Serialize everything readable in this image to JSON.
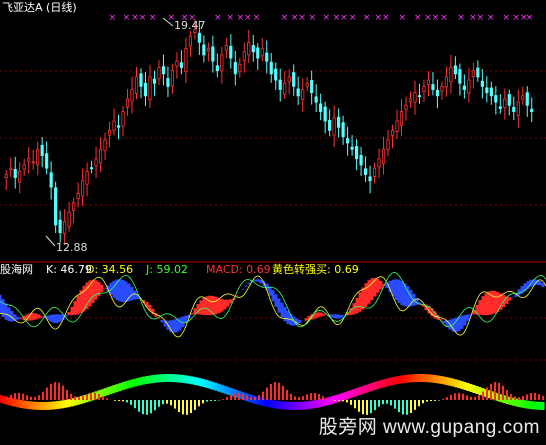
{
  "title": "飞亚达A (日线)",
  "high_marker": "19.47",
  "low_marker": "12.88",
  "indicator": {
    "name": "股海网",
    "k": "K: 46.79",
    "d": "D: 34.56",
    "j": "J: 59.02",
    "macd": "MACD: 0.69",
    "signal": "黄色转强买: 0.69"
  },
  "watermark": "股旁网 www.gupang.com",
  "colors": {
    "background": "#000000",
    "candle_up": "#ff3232",
    "candle_down": "#54ffff",
    "marker": "#ff33ff",
    "grid": "#8b0000"
  },
  "chart_data": [
    {
      "type": "candlestick",
      "title": "飞亚达A (日线)",
      "annotations": [
        {
          "label": "19.47",
          "meaning": "period high"
        },
        {
          "label": "12.88",
          "meaning": "period low"
        }
      ],
      "close": [
        14.8,
        15.0,
        14.7,
        14.9,
        15.1,
        15.3,
        15.2,
        15.6,
        15.4,
        15.0,
        14.4,
        13.2,
        12.95,
        13.3,
        13.6,
        13.9,
        14.2,
        14.6,
        14.9,
        15.0,
        15.3,
        15.6,
        15.9,
        16.2,
        16.5,
        16.3,
        16.8,
        17.2,
        17.5,
        17.9,
        17.6,
        17.3,
        17.9,
        17.7,
        18.2,
        18.0,
        17.6,
        18.1,
        18.4,
        18.2,
        18.8,
        19.2,
        19.4,
        19.0,
        18.6,
        18.8,
        18.4,
        18.1,
        18.6,
        18.9,
        18.5,
        18.0,
        18.3,
        18.7,
        19.0,
        18.7,
        18.5,
        18.8,
        18.4,
        18.0,
        17.8,
        17.5,
        17.7,
        17.9,
        17.6,
        17.3,
        17.5,
        17.7,
        17.4,
        17.1,
        16.8,
        16.5,
        16.2,
        16.6,
        16.3,
        16.0,
        15.8,
        15.6,
        15.3,
        15.1,
        14.8,
        14.6,
        15.0,
        15.3,
        15.6,
        15.9,
        16.2,
        16.5,
        16.8,
        17.0,
        17.2,
        17.4,
        17.3,
        17.6,
        17.8,
        17.5,
        17.3,
        17.6,
        17.9,
        18.2,
        18.0,
        17.7,
        17.5,
        17.8,
        18.1,
        17.9,
        17.6,
        17.4,
        17.3,
        17.1,
        16.9,
        17.2,
        17.0,
        16.8,
        17.1,
        17.3,
        17.0,
        16.8
      ],
      "markers_top": [
        8,
        17,
        25,
        34,
        46,
        57,
        76,
        84,
        93,
        101,
        119,
        128,
        137,
        146,
        155,
        163,
        172,
        182,
        195,
        205,
        214,
        222,
        233,
        243,
        252,
        262,
        271,
        277
      ]
    },
    {
      "type": "line",
      "title": "股海网",
      "series": [
        {
          "name": "K",
          "last": 46.79
        },
        {
          "name": "D",
          "last": 34.56
        },
        {
          "name": "J",
          "last": 59.02
        },
        {
          "name": "MACD",
          "last": 0.69
        },
        {
          "name": "黄色转强买",
          "last": 0.69
        }
      ]
    }
  ]
}
